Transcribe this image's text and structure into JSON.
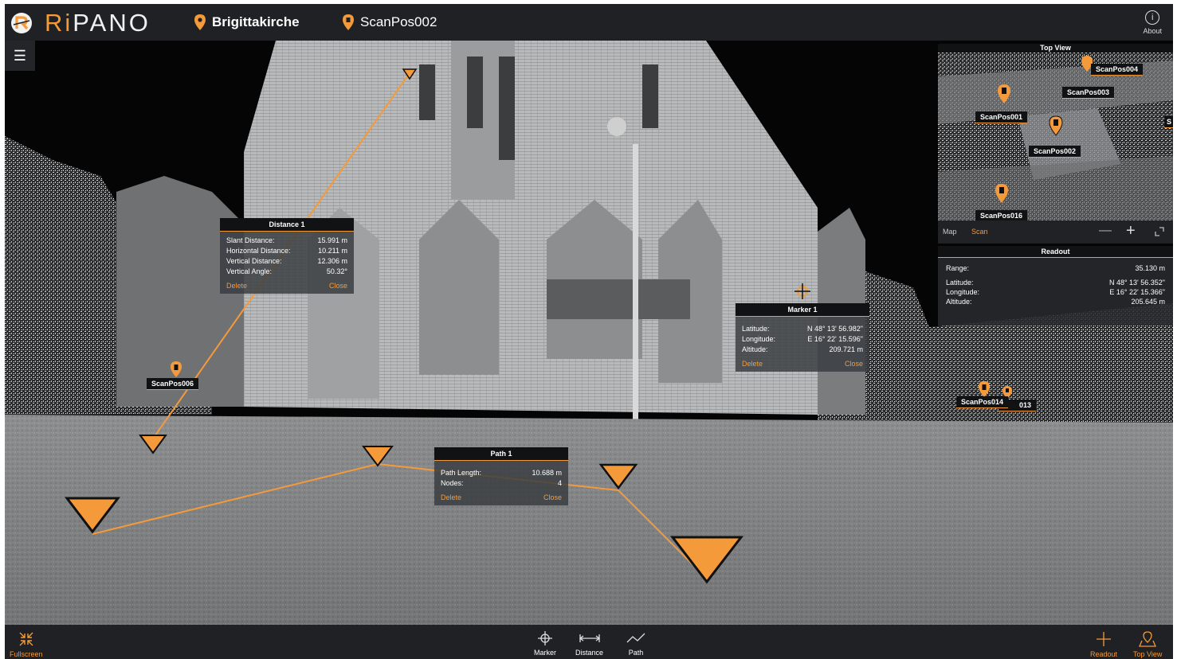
{
  "app": {
    "name_prefix": "Ri",
    "name_suffix": "PANO"
  },
  "header": {
    "project": "Brigittakirche",
    "scan_position": "ScanPos002",
    "about_label": "About"
  },
  "colors": {
    "accent": "#f59a3b",
    "bar": "#1f2124",
    "panel": "#111214"
  },
  "distance_popup": {
    "title": "Distance 1",
    "rows": [
      {
        "label": "Slant Distance:",
        "value": "15.991 m"
      },
      {
        "label": "Horizontal Distance:",
        "value": "10.211 m"
      },
      {
        "label": "Vertical Distance:",
        "value": "12.306 m"
      },
      {
        "label": "Vertical Angle:",
        "value": "50.32°"
      }
    ],
    "delete_label": "Delete",
    "close_label": "Close"
  },
  "marker_popup": {
    "title": "Marker 1",
    "rows": [
      {
        "label": "Latitude:",
        "value": "N 48° 13' 56.982\""
      },
      {
        "label": "Longitude:",
        "value": "E 16° 22' 15.596\""
      },
      {
        "label": "Altitude:",
        "value": "209.721 m"
      }
    ],
    "delete_label": "Delete",
    "close_label": "Close"
  },
  "path_popup": {
    "title": "Path 1",
    "rows": [
      {
        "label": "Path Length:",
        "value": "10.688 m"
      },
      {
        "label": "Nodes:",
        "value": "4"
      }
    ],
    "delete_label": "Delete",
    "close_label": "Close"
  },
  "scene_labels": {
    "scanpos006": "ScanPos006",
    "scanpos014": "ScanPos014",
    "scanpos013_partial": "013"
  },
  "top_view": {
    "title": "Top View",
    "labels": [
      "ScanPos004",
      "ScanPos003",
      "ScanPos001",
      "ScanPos002",
      "ScanPos016"
    ],
    "edge_label": "S",
    "tab_map": "Map",
    "tab_scan": "Scan",
    "zoom_out": "—",
    "zoom_in": "+"
  },
  "readout": {
    "title": "Readout",
    "range_label": "Range:",
    "range_value": "35.130 m",
    "rows": [
      {
        "label": "Latitude:",
        "value": "N 48° 13' 56.352\""
      },
      {
        "label": "Longitude:",
        "value": "E 16° 22' 15.366\""
      },
      {
        "label": "Altitude:",
        "value": "205.645 m"
      }
    ]
  },
  "bottom_bar": {
    "fullscreen": "Fullscreen",
    "marker": "Marker",
    "distance": "Distance",
    "path": "Path",
    "readout": "Readout",
    "top_view": "Top View"
  }
}
